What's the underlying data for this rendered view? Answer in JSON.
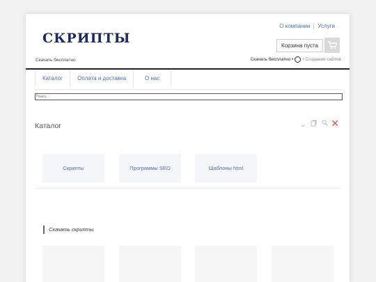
{
  "logo": "СКРИПТЫ",
  "top_links": [
    "О компании",
    "Услуги"
  ],
  "cart": {
    "label": "Корзина пуста"
  },
  "subtitle_left": "Скачать бесплатно",
  "subtitle_right": {
    "part1": "Скачать бесплатно •",
    "part2": "• Создание сайтов"
  },
  "nav": [
    "Каталог",
    "Оплата и доставка",
    "О нас"
  ],
  "search": {
    "placeholder": "Поиск..."
  },
  "catalog": {
    "title": "Каталог",
    "items": [
      "Скрипты",
      "Программы SEO",
      "Шаблоны html"
    ]
  },
  "section": {
    "title": "Скачать скрипты"
  },
  "colors": {
    "accent": "#4a6fb5",
    "logo": "#1d2b5c",
    "close": "#d9534f"
  }
}
